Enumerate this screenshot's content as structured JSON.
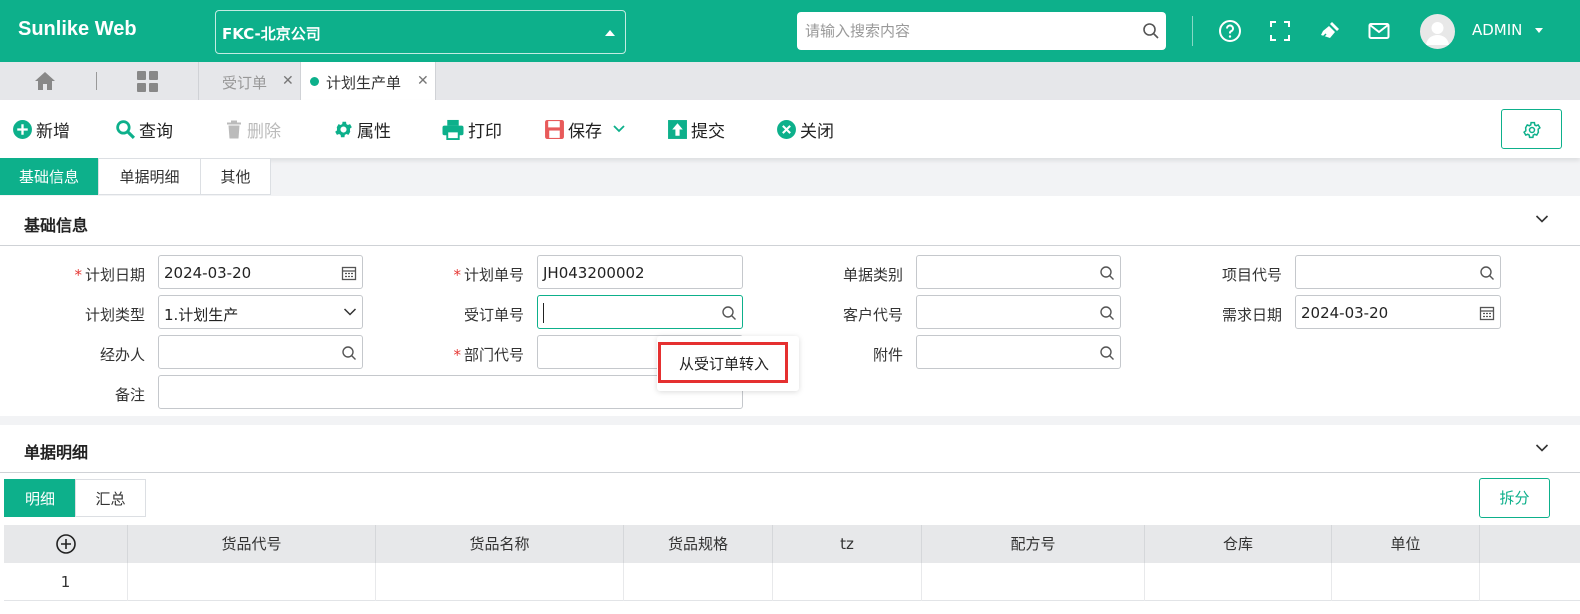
{
  "app": {
    "brand": "Sunlike Web",
    "company": "FKC-北京公司",
    "search_placeholder": "请输入搜索内容",
    "user": "ADMIN"
  },
  "colors": {
    "primary": "#0db08b",
    "required": "#e53935",
    "highlight_border": "#e53030"
  },
  "tabs": [
    {
      "label": "受订单",
      "active": false
    },
    {
      "label": "计划生产单",
      "active": true
    }
  ],
  "toolbar": {
    "new": "新增",
    "query": "查询",
    "delete": "删除",
    "properties": "属性",
    "print": "打印",
    "save": "保存",
    "submit": "提交",
    "close": "关闭"
  },
  "section_tabs": [
    "基础信息",
    "单据明细",
    "其他"
  ],
  "basic": {
    "title": "基础信息",
    "fields": {
      "plan_date": {
        "label": "计划日期",
        "value": "2024-03-20",
        "required": true
      },
      "plan_no": {
        "label": "计划单号",
        "value": "JH043200002",
        "required": true
      },
      "doc_category": {
        "label": "单据类别",
        "value": ""
      },
      "project_code": {
        "label": "项目代号",
        "value": ""
      },
      "plan_type": {
        "label": "计划类型",
        "value": "1.计划生产"
      },
      "order_no": {
        "label": "受订单号",
        "value": ""
      },
      "customer_code": {
        "label": "客户代号",
        "value": ""
      },
      "demand_date": {
        "label": "需求日期",
        "value": "2024-03-20"
      },
      "handler": {
        "label": "经办人",
        "value": ""
      },
      "dept_code": {
        "label": "部门代号",
        "value": "",
        "required": true
      },
      "attachment": {
        "label": "附件",
        "value": ""
      },
      "remark": {
        "label": "备注",
        "value": ""
      }
    },
    "popup": "从受订单转入"
  },
  "detail": {
    "title": "单据明细",
    "tabs": [
      "明细",
      "汇总"
    ],
    "split": "拆分",
    "columns": [
      "货品代号",
      "货品名称",
      "货品规格",
      "tz",
      "配方号",
      "仓库",
      "单位"
    ],
    "rows": [
      {
        "index": "1"
      }
    ]
  }
}
